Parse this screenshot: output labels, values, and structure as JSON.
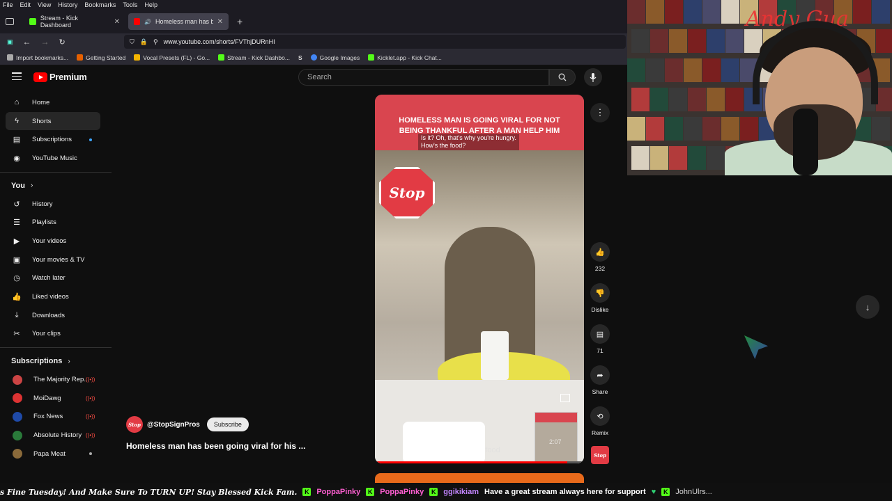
{
  "browser": {
    "menu": [
      "File",
      "Edit",
      "View",
      "History",
      "Bookmarks",
      "Tools",
      "Help"
    ],
    "tabs": [
      {
        "label": "Stream - Kick Dashboard",
        "active": false,
        "favicon_color": "#53fc18"
      },
      {
        "label": "Homeless man has been go",
        "active": true,
        "favicon_color": "#ff0000"
      }
    ],
    "url": "www.youtube.com/shorts/FVThjDURnHI",
    "bookmarks": [
      "Import bookmarks...",
      "Getting Started",
      "Vocal Presets (FL) - Go...",
      "Stream - Kick Dashbo...",
      "S",
      "Google Images",
      "Kicklet.app - Kick Chat..."
    ]
  },
  "youtube": {
    "logo_text": "Premium",
    "search_placeholder": "Search",
    "sidebar": {
      "main": [
        {
          "label": "Home",
          "icon": "home-icon"
        },
        {
          "label": "Shorts",
          "icon": "shorts-icon",
          "active": true
        },
        {
          "label": "Subscriptions",
          "icon": "subscriptions-icon",
          "dot": true
        },
        {
          "label": "YouTube Music",
          "icon": "music-icon"
        }
      ],
      "you_title": "You",
      "you": [
        {
          "label": "History",
          "icon": "history-icon"
        },
        {
          "label": "Playlists",
          "icon": "playlists-icon"
        },
        {
          "label": "Your videos",
          "icon": "your-videos-icon"
        },
        {
          "label": "Your movies & TV",
          "icon": "movies-icon"
        },
        {
          "label": "Watch later",
          "icon": "clock-icon"
        },
        {
          "label": "Liked videos",
          "icon": "thumbs-up-icon"
        },
        {
          "label": "Downloads",
          "icon": "download-icon"
        },
        {
          "label": "Your clips",
          "icon": "scissors-icon"
        }
      ],
      "subs_title": "Subscriptions",
      "subscriptions": [
        {
          "label": "The Majority Rep...",
          "live": true,
          "color": "#c44"
        },
        {
          "label": "MoiDawg",
          "live": true,
          "color": "#d33"
        },
        {
          "label": "Fox News",
          "live": true,
          "color": "#1f4aa8"
        },
        {
          "label": "Absolute History",
          "live": true,
          "color": "#2a7a3a"
        },
        {
          "label": "Papa Meat",
          "dot": true,
          "color": "#8a6a3a"
        }
      ]
    },
    "short": {
      "banner_text": "HOMELESS MAN IS GOING VIRAL FOR NOT BEING THANKFUL AFTER A MAN HELP HIM",
      "caption_line1": "Is it? Oh, that's why you're hungry.",
      "caption_line2": "How's the food?",
      "sign_text": "Stop",
      "watermark": "the food",
      "timer": "2:07",
      "progress": 0.92,
      "channel": "@StopSignPros",
      "subscribe_label": "Subscribe",
      "title": "Homeless man has been going viral for his ..."
    },
    "actions": {
      "like_count": "232",
      "dislike_label": "Dislike",
      "comment_count": "71",
      "share_label": "Share",
      "remix_label": "Remix"
    }
  },
  "ticker": {
    "lead": "s Fine Tuesday! And Make Sure To TURN UP! Stay Blessed Kick Fam.",
    "name1": "PoppaPinky",
    "name2": "PoppaPinky",
    "name3": "ggikikiam",
    "msg": "Have a great stream always here for support",
    "name4": "JohnUlrs..."
  },
  "webcam": {
    "sign_text": "Andy Gua"
  }
}
